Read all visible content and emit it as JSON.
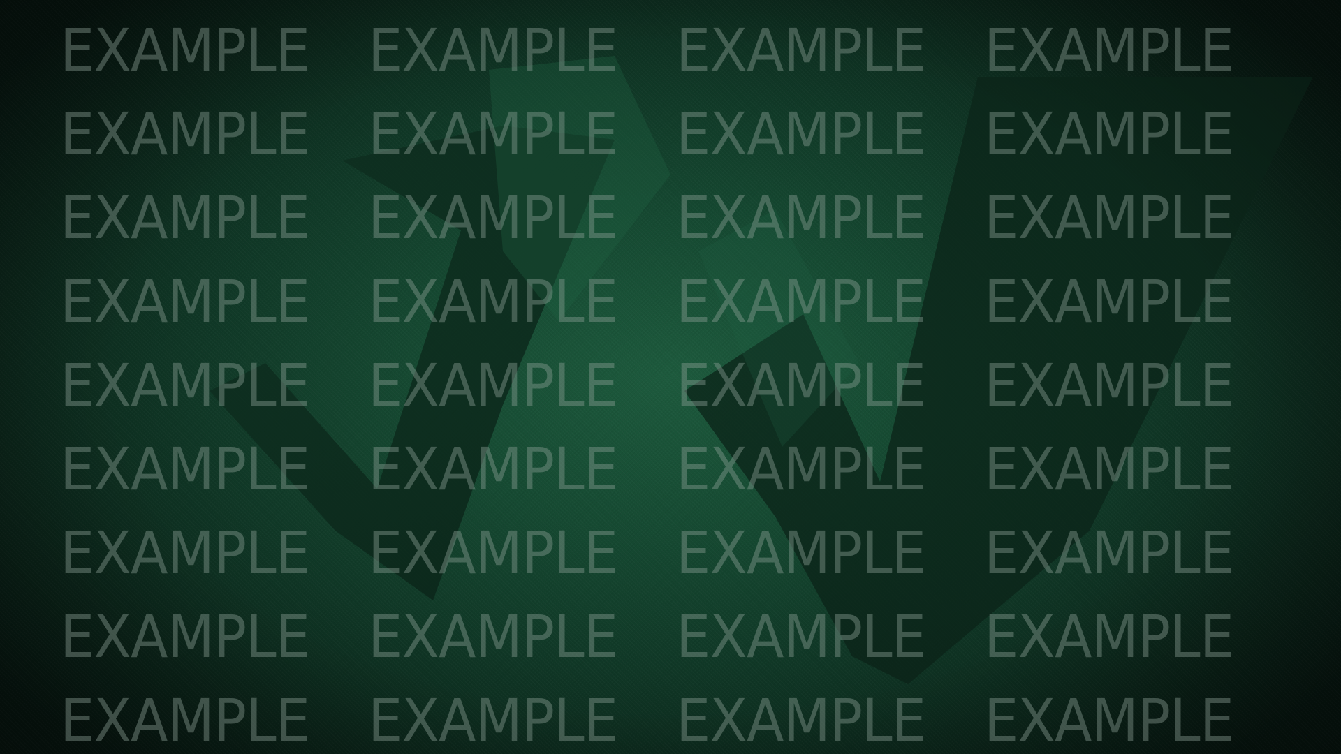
{
  "watermark": {
    "text": "EXAMPLE",
    "rows": 9,
    "columns": 4,
    "color": "#8ca096"
  },
  "background": {
    "center_color": "#1d5a3d",
    "edge_color": "#071610",
    "emblem": "stylized-v-chevron-shape"
  }
}
